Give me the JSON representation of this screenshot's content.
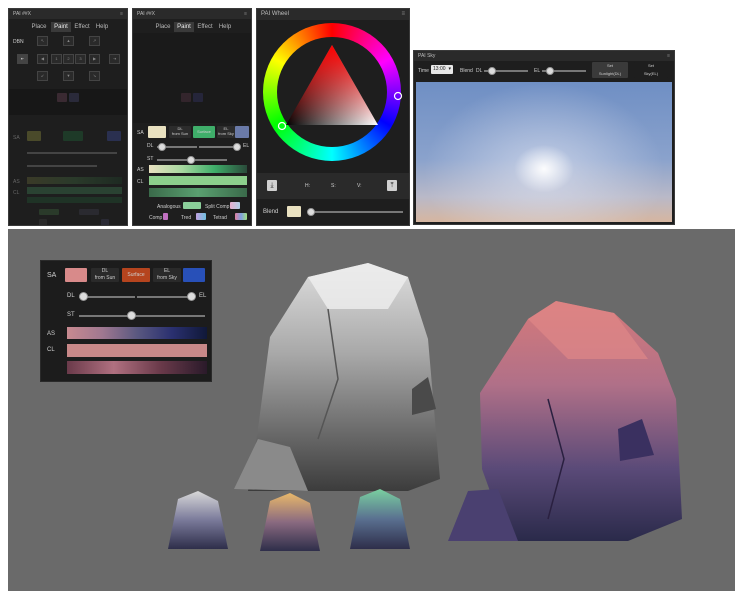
{
  "panels": {
    "p1": {
      "title": "PAI ##X",
      "tabs": [
        "Place",
        "Paint",
        "Effect",
        "Help"
      ],
      "active_tab": "Paint",
      "row_label": "DBN",
      "center_numbers": [
        "1",
        "2",
        "3"
      ],
      "side_labels": [
        "SA",
        "AS",
        "CL"
      ]
    },
    "p2": {
      "title": "PAI ##X",
      "tabs": [
        "Place",
        "Paint",
        "Effect",
        "Help"
      ],
      "active_tab": "Paint",
      "sa_label": "SA",
      "dl_from_sun": "DL\nfrom Sun",
      "surface": "Surface",
      "el_from_sky": "EL\nfrom Sky",
      "dl": "DL",
      "el": "EL",
      "st": "ST",
      "as": "AS",
      "cl": "CL",
      "analogous": "Analogous",
      "split_comp": "Split Comp",
      "comp": "Comp",
      "tred": "Tred",
      "tetrad": "Tetrad"
    },
    "p3": {
      "title": "PAI Wheel",
      "h": "H:",
      "s": "S:",
      "v": "V:",
      "blend": "Blend"
    },
    "p4": {
      "title": "PAI Sky",
      "time_label": "Time",
      "time_value": "13:00",
      "blend": "Blend",
      "dl": "DL",
      "el": "EL",
      "set_sunlight": "Set\nSunlight(DL)",
      "set_sky": "Set\nSky(EL)"
    },
    "big": {
      "sa": "SA",
      "dl_from_sun": "DL\nfrom Sun",
      "surface": "Surface",
      "el_from_sky": "EL\nfrom Sky",
      "dl": "DL",
      "el": "EL",
      "st": "ST",
      "as": "AS",
      "cl": "CL"
    }
  },
  "colors": {
    "panel_bg": "#1e1e1e",
    "canvas_bg": "#6a6a6a",
    "sa_pink": "#d88a8a",
    "surface_orange": "#b5441e",
    "sky_blue": "#2850b8",
    "surface_green": "#3fae6a",
    "cream": "#e9e1c0",
    "slate": "#6a7aa8"
  }
}
